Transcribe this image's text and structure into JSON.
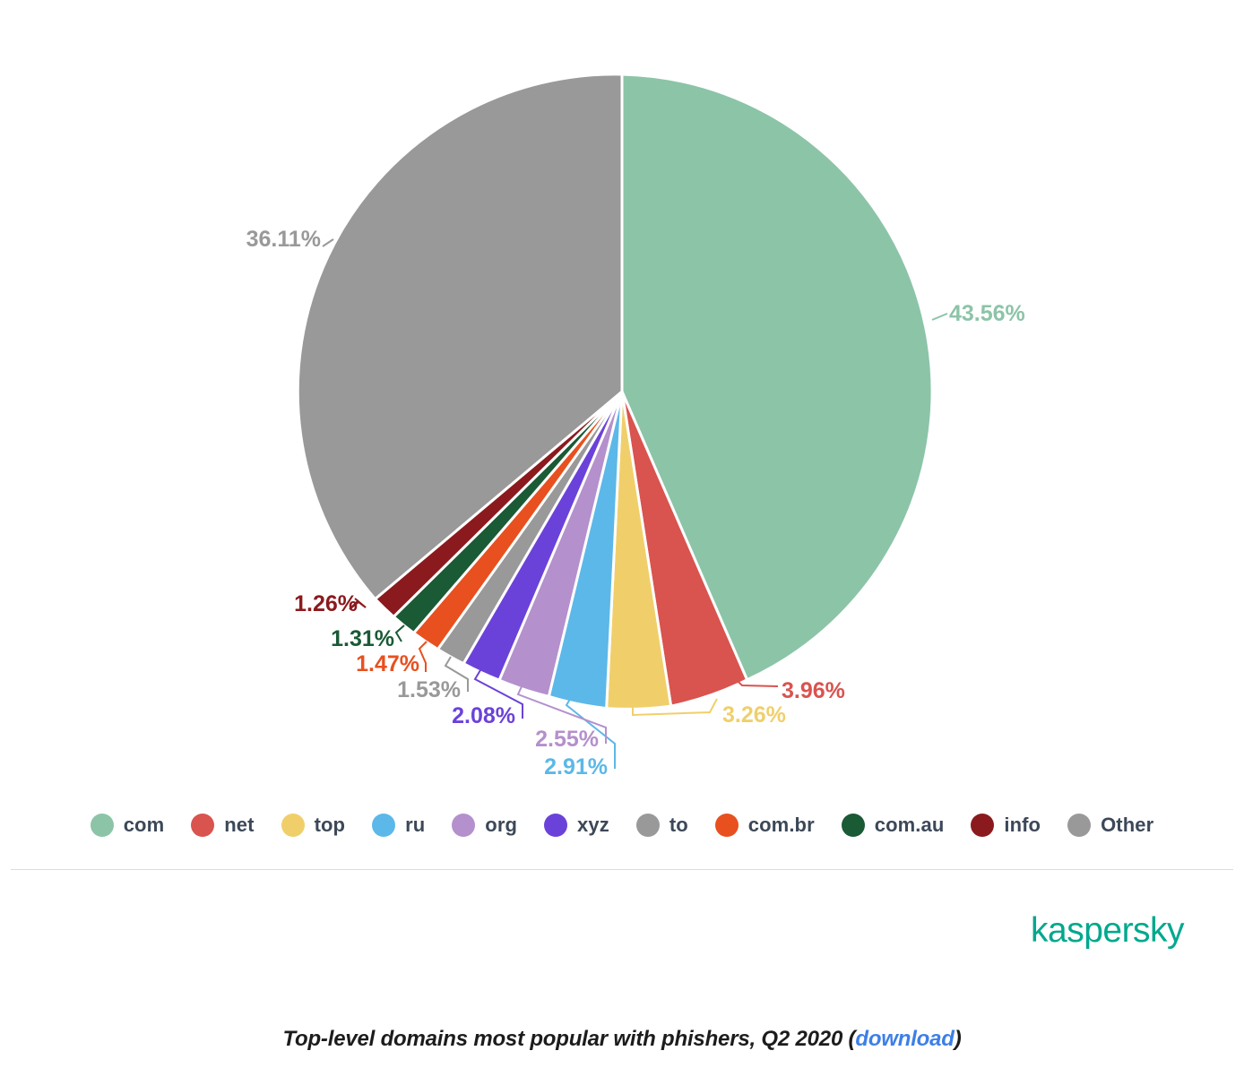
{
  "caption": {
    "text_before": "Top-level domains most popular with phishers, Q2 2020 (",
    "link_label": "download",
    "text_after": ")"
  },
  "brand": {
    "name": "kaspersky",
    "color": "#00a88e"
  },
  "divider": {
    "color": "#dcdcdc"
  },
  "legend": {
    "items": [
      {
        "label": "com",
        "color": "#8cc4a8"
      },
      {
        "label": "net",
        "color": "#d9534f"
      },
      {
        "label": "top",
        "color": "#f0cf6b"
      },
      {
        "label": "ru",
        "color": "#5cb8e8"
      },
      {
        "label": "org",
        "color": "#b490cc"
      },
      {
        "label": "xyz",
        "color": "#6b42d9"
      },
      {
        "label": "to",
        "color": "#999999"
      },
      {
        "label": "com.br",
        "color": "#e8501f"
      },
      {
        "label": "com.au",
        "color": "#1a5a35"
      },
      {
        "label": "info",
        "color": "#8b1a1e"
      },
      {
        "label": "Other",
        "color": "#999999"
      }
    ]
  },
  "chart_data": {
    "type": "pie",
    "title": "Top-level domains most popular with phishers, Q2 2020",
    "unit": "%",
    "start_angle_deg": 0,
    "direction": "clockwise",
    "categories": [
      "com",
      "net",
      "top",
      "ru",
      "org",
      "xyz",
      "to",
      "com.br",
      "com.au",
      "info",
      "Other"
    ],
    "values": [
      43.56,
      3.96,
      3.26,
      2.91,
      2.55,
      2.08,
      1.53,
      1.47,
      1.31,
      1.26,
      36.11
    ],
    "labels": [
      "43.56%",
      "3.96%",
      "3.26%",
      "2.91%",
      "2.55%",
      "2.08%",
      "1.53%",
      "1.47%",
      "1.31%",
      "1.26%",
      "36.11%"
    ],
    "colors": [
      "#8cc4a8",
      "#d9534f",
      "#f0cf6b",
      "#5cb8e8",
      "#b490cc",
      "#6b42d9",
      "#999999",
      "#e8501f",
      "#1a5a35",
      "#8b1a1e",
      "#999999"
    ],
    "legend_position": "bottom",
    "grid": false
  },
  "percent_labels": {
    "com": "43.56%",
    "net": "3.96%",
    "top": "3.26%",
    "ru": "2.91%",
    "org": "2.55%",
    "xyz": "2.08%",
    "to": "1.53%",
    "com_br": "1.47%",
    "com_au": "1.31%",
    "info": "1.26%",
    "other": "36.11%"
  }
}
